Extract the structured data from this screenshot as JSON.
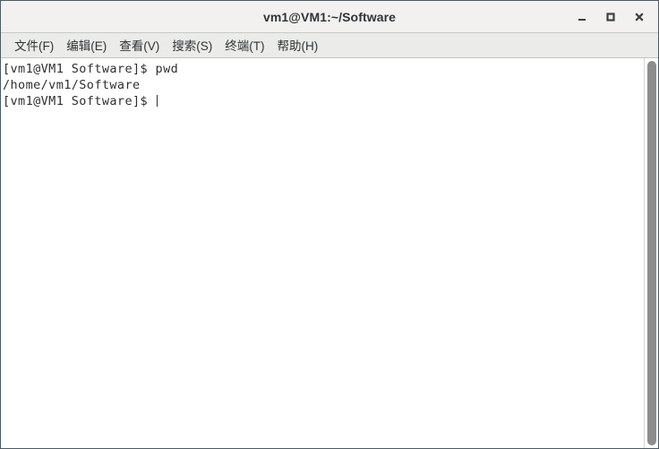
{
  "window": {
    "title": "vm1@VM1:~/Software",
    "controls": [
      {
        "name": "minimize-button",
        "label": "_"
      },
      {
        "name": "maximize-button",
        "label": "□"
      },
      {
        "name": "close-button",
        "label": "✕"
      }
    ]
  },
  "menubar": {
    "items": [
      {
        "label": "文件(F)"
      },
      {
        "label": "编辑(E)"
      },
      {
        "label": "查看(V)"
      },
      {
        "label": "搜索(S)"
      },
      {
        "label": "终端(T)"
      },
      {
        "label": "帮助(H)"
      }
    ]
  },
  "terminal": {
    "lines": [
      {
        "text": "[vm1@VM1 Software]$ pwd"
      },
      {
        "text": "/home/vm1/Software"
      },
      {
        "text": "[vm1@VM1 Software]$ "
      }
    ],
    "prompt": "[vm1@VM1 Software]$ ",
    "command": "pwd",
    "output": "/home/vm1/Software",
    "cursor_visible": true,
    "foreground_color": "#2f2f2f",
    "background_color": "#ffffff"
  },
  "colors": {
    "window_border": "#4c5a63",
    "titlebar_bg": "#f2f1f0",
    "menubar_bg": "#ebebe9",
    "scrollbar_thumb": "#8d8d8d"
  }
}
